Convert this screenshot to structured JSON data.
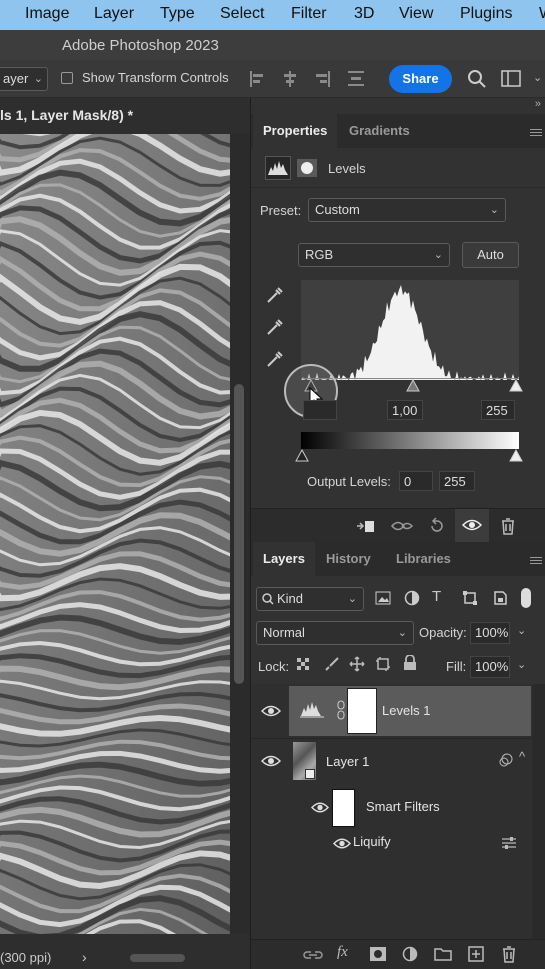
{
  "menubar": {
    "items": [
      "Image",
      "Layer",
      "Type",
      "Select",
      "Filter",
      "3D",
      "View",
      "Plugins",
      "W"
    ]
  },
  "app_title": "Adobe Photoshop 2023",
  "options": {
    "layer_select": "ayer",
    "show_transform_label": "Show Transform Controls",
    "share_label": "Share"
  },
  "document": {
    "tab_label": "ls 1, Layer Mask/8) *",
    "status": "(300 ppi)"
  },
  "properties": {
    "tabs": [
      "Properties",
      "Gradients"
    ],
    "adjustment_name": "Levels",
    "preset_label": "Preset:",
    "preset_value": "Custom",
    "channel_value": "RGB",
    "auto_label": "Auto",
    "input_black": "",
    "input_mid": "1,00",
    "input_white": "255",
    "output_label": "Output Levels:",
    "output_black": "0",
    "output_white": "255"
  },
  "layers_panel": {
    "tabs": [
      "Layers",
      "History",
      "Libraries"
    ],
    "filter_kind": "Kind",
    "blend_mode": "Normal",
    "opacity_label": "Opacity:",
    "opacity_value": "100%",
    "lock_label": "Lock:",
    "fill_label": "Fill:",
    "fill_value": "100%",
    "layers": [
      {
        "name": "Levels 1"
      },
      {
        "name": "Layer 1"
      },
      {
        "name": "Smart Filters"
      },
      {
        "name": "Liquify"
      }
    ]
  },
  "colors": {
    "accent": "#1473e6",
    "menubar": "#8fc4ee",
    "panel": "#323232"
  }
}
